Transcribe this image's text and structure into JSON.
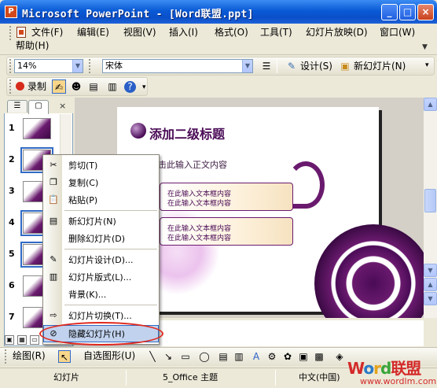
{
  "window": {
    "title": "Microsoft PowerPoint - [Word联盟.ppt]",
    "app_icon": "powerpoint-icon",
    "buttons": {
      "minimize": "_",
      "maximize": "□",
      "close": "×"
    }
  },
  "menubar": {
    "items": [
      "文件(F)",
      "编辑(E)",
      "视图(V)",
      "插入(I)",
      "格式(O)",
      "工具(T)",
      "幻灯片放映(D)",
      "窗口(W)"
    ],
    "help": "帮助(H)"
  },
  "format_toolbar": {
    "zoom": "14%",
    "font": "宋体",
    "design_label": "设计(S)",
    "new_slide_label": "新幻灯片(N)"
  },
  "record_toolbar": {
    "record_label": "录制"
  },
  "slide_panel": {
    "numbers": [
      "1",
      "2",
      "3",
      "4",
      "5",
      "6",
      "7"
    ],
    "selected": [
      2,
      4,
      5
    ]
  },
  "slide": {
    "title": "添加二级标题",
    "body_prompt": "单击此输入正文内容",
    "box1": [
      "在此输入文本框内容",
      "在此输入文本框内容"
    ],
    "box2": [
      "在此输入文本框内容",
      "在此输入文本框内容"
    ]
  },
  "context_menu": {
    "cut": "剪切(T)",
    "copy": "复制(C)",
    "paste": "粘贴(P)",
    "new_slide": "新幻灯片(N)",
    "delete_slide": "删除幻灯片(D)",
    "slide_design": "幻灯片设计(D)...",
    "slide_layout": "幻灯片版式(L)...",
    "background": "背景(K)...",
    "slide_transition": "幻灯片切换(T)...",
    "hide_slide": "隐藏幻灯片(H)"
  },
  "draw_toolbar": {
    "draw_label": "绘图(R)",
    "autoshape_label": "自选图形(U)"
  },
  "statusbar": {
    "view": "幻灯片",
    "design": "5_Office 主题",
    "language": "中文(中国)"
  },
  "watermark": {
    "logo": "Word联盟",
    "url": "www.wordlm.com"
  },
  "colors": {
    "titlebar": "#0a5ad6",
    "accent_purple": "#4a0b56",
    "highlight_circle": "#e0281e"
  }
}
